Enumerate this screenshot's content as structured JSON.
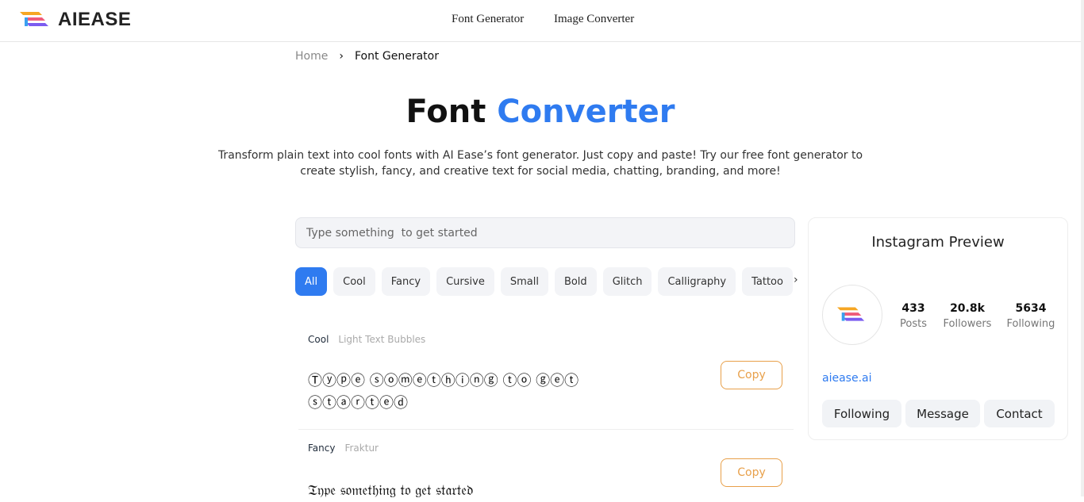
{
  "header": {
    "brand": "AIEASE",
    "nav": [
      "Font Generator",
      "Image Converter"
    ]
  },
  "breadcrumb": {
    "home": "Home",
    "current": "Font Generator"
  },
  "hero": {
    "title_a": "Font",
    "title_b": "Converter",
    "subtitle": "Transform plain text into cool fonts with AI Ease’s font generator. Just copy and paste! Try our free font generator to create stylish, fancy, and creative text for social media, chatting, branding, and more!"
  },
  "input": {
    "placeholder": "Type something  to get started",
    "value": ""
  },
  "tabs": [
    "All",
    "Cool",
    "Fancy",
    "Cursive",
    "Small",
    "Bold",
    "Glitch",
    "Calligraphy",
    "Tattoo"
  ],
  "results": [
    {
      "category": "Cool",
      "style": "Light Text Bubbles",
      "text": "Ⓣⓨⓟⓔ ⓢⓞⓜⓔⓣⓗⓘⓝⓖ ⓣⓞ ⓖⓔⓣ ⓢⓣⓐⓡⓣⓔⓓ",
      "copy": "Copy"
    },
    {
      "category": "Fancy",
      "style": "Fraktur",
      "text": "𝔗𝔶𝔭𝔢 𝔰𝔬𝔪𝔢𝔱𝔥𝔦𝔫𝔤 𝔱𝔬 𝔤𝔢𝔱 𝔰𝔱𝔞𝔯𝔱𝔢𝔡",
      "copy": "Copy"
    }
  ],
  "instagram": {
    "title": "Instagram Preview",
    "stats": [
      {
        "value": "433",
        "label": "Posts"
      },
      {
        "value": "20.8k",
        "label": "Followers"
      },
      {
        "value": "5634",
        "label": "Following"
      }
    ],
    "link": "aiease.ai",
    "buttons": [
      "Following",
      "Message",
      "Contact"
    ]
  },
  "colors": {
    "accent": "#2f7bf0",
    "copy": "#e8a04a"
  }
}
